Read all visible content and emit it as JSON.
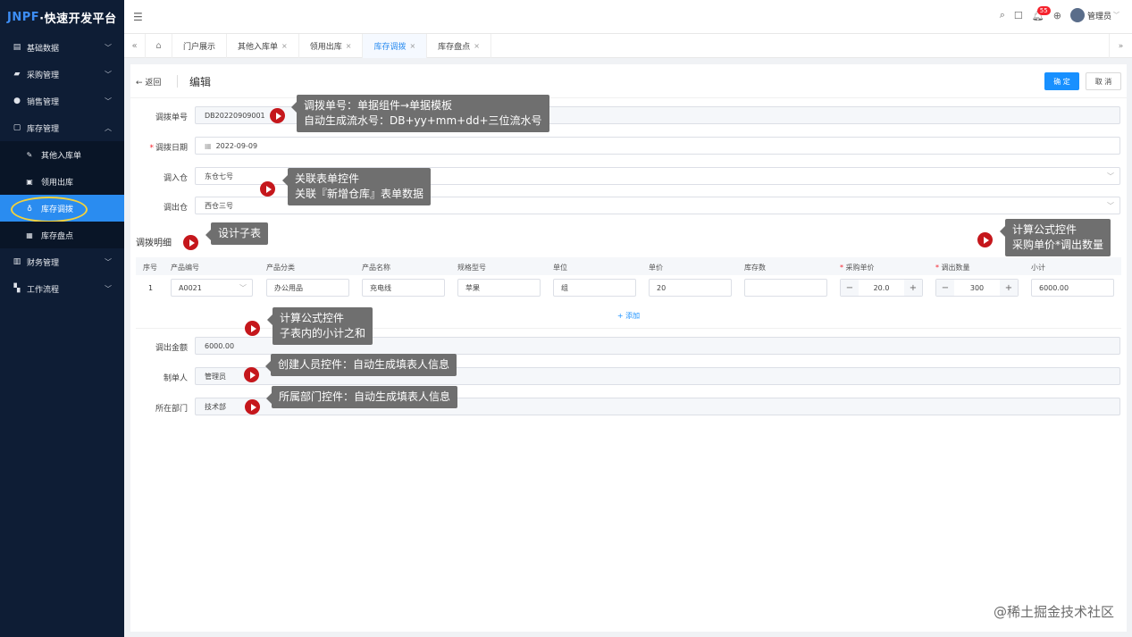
{
  "app": {
    "logo_prefix": "JNPF",
    "logo_suffix": "·快速开发平台"
  },
  "sidebar": {
    "items": [
      {
        "label": "基础数据",
        "icon": "document-icon"
      },
      {
        "label": "采购管理",
        "icon": "truck-icon"
      },
      {
        "label": "销售管理",
        "icon": "user-icon"
      },
      {
        "label": "库存管理",
        "icon": "inventory-icon",
        "expanded": true
      }
    ],
    "subitems": [
      {
        "label": "其他入库单"
      },
      {
        "label": "领用出库"
      },
      {
        "label": "库存调拨",
        "active": true
      },
      {
        "label": "库存盘点"
      }
    ],
    "items_after": [
      {
        "label": "财务管理"
      },
      {
        "label": "工作流程"
      }
    ]
  },
  "header": {
    "badge": "55",
    "user": "管理员"
  },
  "tabs": [
    {
      "label": "门户展示",
      "closable": false
    },
    {
      "label": "其他入库单",
      "closable": true
    },
    {
      "label": "领用出库",
      "closable": true
    },
    {
      "label": "库存调拨",
      "closable": true,
      "active": true
    },
    {
      "label": "库存盘点",
      "closable": true
    }
  ],
  "page": {
    "back": "返回",
    "title": "编辑",
    "ok": "确 定",
    "cancel": "取 消"
  },
  "form": {
    "no_label": "调拨单号",
    "no_value": "DB20220909001",
    "date_label": "调拨日期",
    "date_value": "2022-09-09",
    "in_label": "调入仓",
    "in_value": "东仓七号",
    "out_label": "调出仓",
    "out_value": "西仓三号",
    "amount_label": "调出金额",
    "amount_value": "6000.00",
    "maker_label": "制单人",
    "maker_value": "管理员",
    "dept_label": "所在部门",
    "dept_value": "技术部"
  },
  "detail": {
    "title": "调拨明细",
    "columns": [
      "序号",
      "产品编号",
      "产品分类",
      "产品名称",
      "规格型号",
      "单位",
      "单价",
      "库存数",
      "采购单价",
      "调出数量",
      "小计"
    ],
    "row": {
      "index": "1",
      "code": "A0021",
      "category": "办公用品",
      "name": "充电线",
      "spec": "苹果",
      "unit": "组",
      "price": "20",
      "stock": "",
      "purchase_price": "20.0",
      "qty": "300",
      "subtotal": "6000.00"
    },
    "add": "+ 添加"
  },
  "callouts": {
    "c1a": "调拨单号：单据组件→单据模板",
    "c1b": "自动生成流水号：DB+yy+mm+dd+三位流水号",
    "c2a": "关联表单控件",
    "c2b": "关联『新增仓库』表单数据",
    "c3": "设计子表",
    "c4a": "计算公式控件",
    "c4b": "采购单价*调出数量",
    "c5a": "计算公式控件",
    "c5b": "子表内的小计之和",
    "c6": "创建人员控件：自动生成填表人信息",
    "c7": "所属部门控件：自动生成填表人信息"
  },
  "watermark": "@稀土掘金技术社区"
}
